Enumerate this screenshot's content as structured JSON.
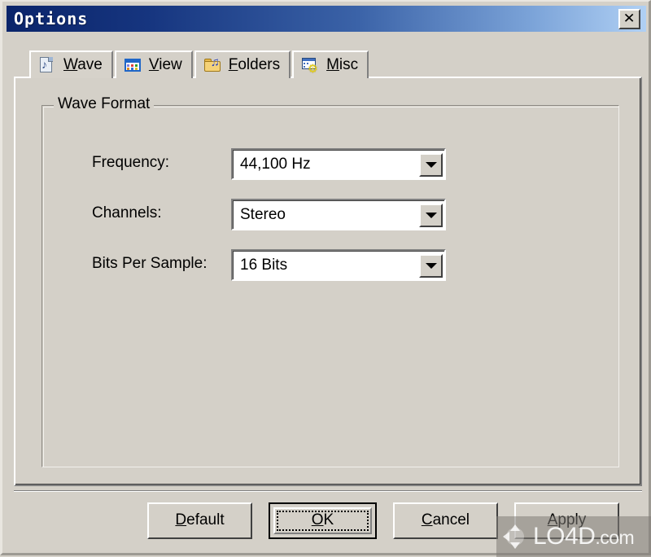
{
  "window": {
    "title": "Options",
    "close_label": "✕",
    "close_icon": "close-icon",
    "colors": {
      "face": "#d4d0c8",
      "title_gradient_start": "#0a246a",
      "title_gradient_end": "#b0d0f4",
      "text": "#000000",
      "field_background": "#ffffff"
    }
  },
  "tabs": [
    {
      "label_before": "",
      "accel": "W",
      "label_after": "ave",
      "icon": "wave-note-page-icon",
      "active": true
    },
    {
      "label_before": "",
      "accel": "V",
      "label_after": "iew",
      "icon": "view-window-dots-icon",
      "active": false
    },
    {
      "label_before": "",
      "accel": "F",
      "label_after": "olders",
      "icon": "folder-music-icon",
      "active": false
    },
    {
      "label_before": "",
      "accel": "M",
      "label_after": "isc",
      "icon": "window-gear-icon",
      "active": false
    }
  ],
  "group": {
    "caption": "Wave Format",
    "rows": [
      {
        "label": "Frequency:",
        "value": "44,100 Hz",
        "arrow_icon": "chevron-down-icon"
      },
      {
        "label": "Channels:",
        "value": "Stereo",
        "arrow_icon": "chevron-down-icon"
      },
      {
        "label": "Bits Per Sample:",
        "value": "16 Bits",
        "arrow_icon": "chevron-down-icon"
      }
    ]
  },
  "buttons": [
    {
      "accel": "D",
      "rest": "efault",
      "default": false
    },
    {
      "accel": "O",
      "rest": "K",
      "default": true
    },
    {
      "accel": "C",
      "rest": "ancel",
      "default": false
    },
    {
      "accel": "A",
      "rest": "pply",
      "default": false
    }
  ],
  "watermark": {
    "name": "LO4D",
    "suffix": ".com",
    "logo_icon": "circular-arrows-icon"
  }
}
